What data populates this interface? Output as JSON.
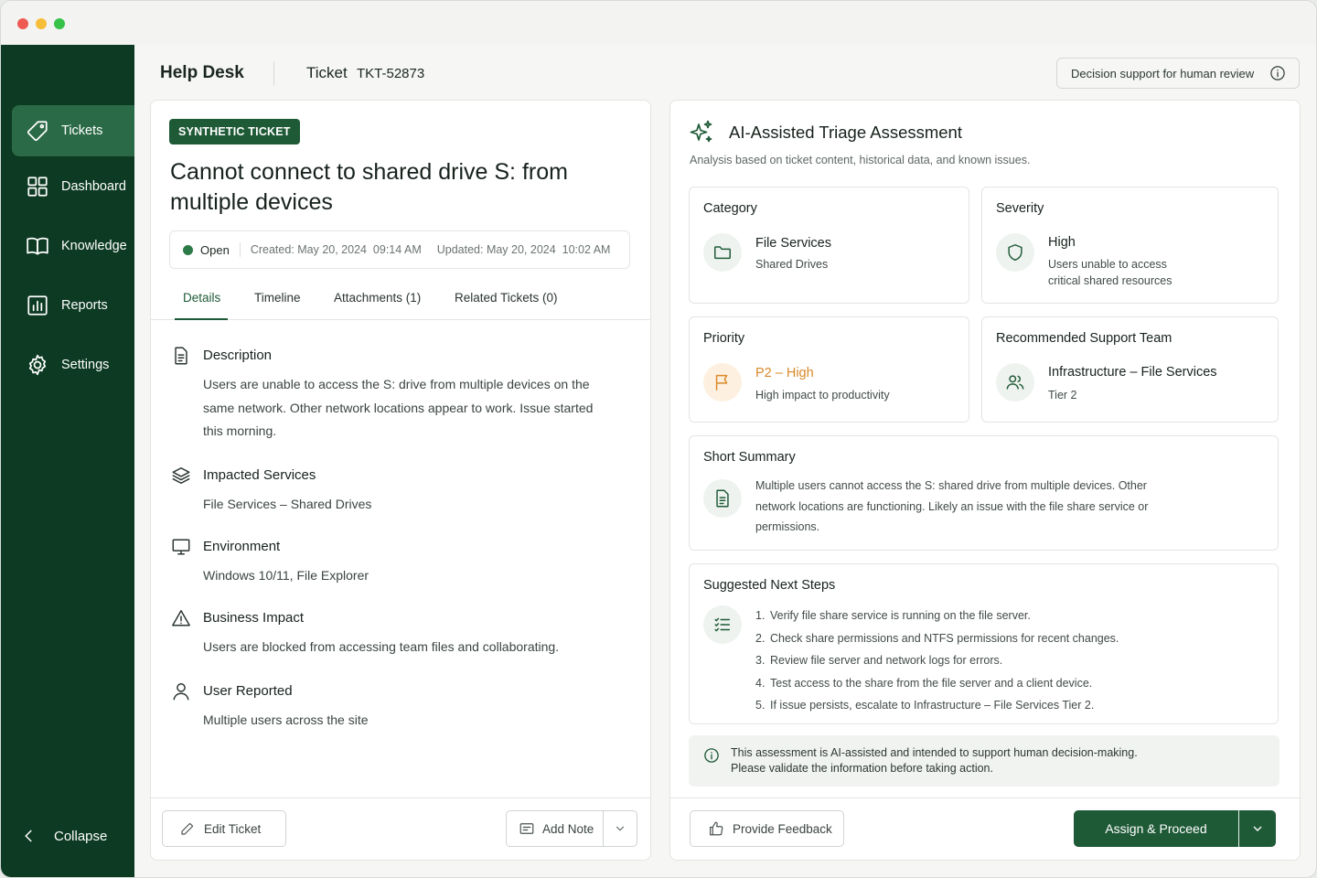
{
  "sidebar": {
    "items": [
      {
        "label": "Tickets",
        "icon": "tag-icon",
        "active": true
      },
      {
        "label": "Dashboard",
        "icon": "grid-icon"
      },
      {
        "label": "Knowledge",
        "icon": "book-icon"
      },
      {
        "label": "Reports",
        "icon": "bar-chart-icon"
      },
      {
        "label": "Settings",
        "icon": "gear-icon"
      }
    ],
    "collapse_label": "Collapse"
  },
  "header": {
    "app_title": "Help Desk",
    "ticket_label": "Ticket",
    "ticket_id": "TKT-52873",
    "decision_support": "Decision support for human review"
  },
  "ticket": {
    "badge": "SYNTHETIC TICKET",
    "title": "Cannot connect to shared drive S: from multiple devices",
    "status": "Open",
    "status_color": "#2c7a47",
    "created": "Created: May 20, 2024  09:14 AM",
    "updated": "Updated: May 20, 2024  10:02 AM",
    "tabs": [
      "Details",
      "Timeline",
      "Attachments (1)",
      "Related Tickets (0)"
    ],
    "sections": {
      "description": {
        "title": "Description",
        "body": "Users are unable to access the S: drive from multiple devices on the same network. Other network locations appear to work. Issue started this morning."
      },
      "impacted": {
        "title": "Impacted Services",
        "body": "File Services – Shared Drives"
      },
      "environment": {
        "title": "Environment",
        "body": "Windows 10/11, File Explorer"
      },
      "impact": {
        "title": "Business Impact",
        "body": "Users are blocked from accessing team files and collaborating."
      },
      "reported": {
        "title": "User Reported",
        "body": "Multiple users across the site"
      }
    },
    "edit_label": "Edit Ticket",
    "note_label": "Add Note"
  },
  "triage": {
    "title": "AI-Assisted Triage Assessment",
    "subtitle": "Analysis based on ticket content, historical data, and known issues.",
    "category": {
      "title": "Category",
      "value": "File Services",
      "sub": "Shared Drives"
    },
    "severity": {
      "title": "Severity",
      "value": "High",
      "sub1": "Users unable to access",
      "sub2": "critical shared resources"
    },
    "priority": {
      "title": "Priority",
      "value": "P2 – High",
      "sub": "High impact to productivity",
      "color": "#d9892a"
    },
    "team": {
      "title": "Recommended Support Team",
      "value": "Infrastructure – File Services",
      "sub": "Tier 2"
    },
    "summary": {
      "title": "Short Summary",
      "body": "Multiple users cannot access the S: shared drive from multiple devices. Other network locations are functioning. Likely an issue with the file share service or permissions."
    },
    "steps": {
      "title": "Suggested Next Steps",
      "items": [
        "Verify file share service is running on the file server.",
        "Check share permissions and NTFS permissions for recent changes.",
        "Review file server and network logs for errors.",
        "Test access to the share from the file server and a client device.",
        "If issue persists, escalate to Infrastructure – File Services Tier 2."
      ]
    },
    "notice_line1": "This assessment is AI-assisted and intended to support human decision-making.",
    "notice_line2": "Please validate the information before taking action.",
    "feedback_label": "Provide Feedback",
    "assign_label": "Assign & Proceed",
    "accent": "#1f5a37"
  }
}
